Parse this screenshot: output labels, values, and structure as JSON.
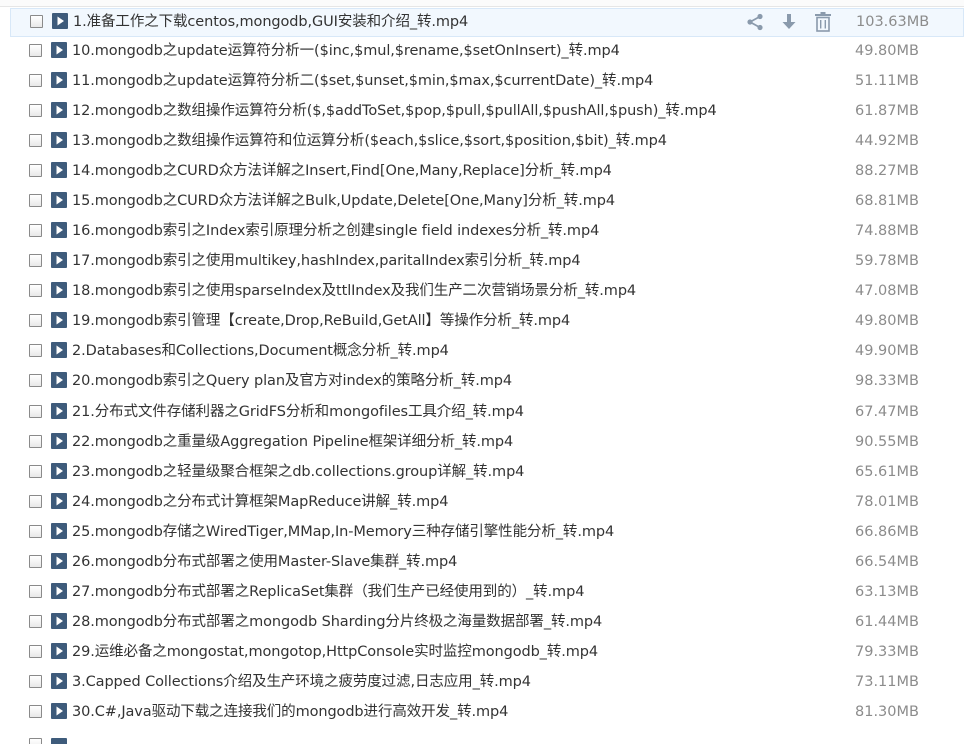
{
  "toolbar_icons": {
    "share": "share-icon",
    "download": "download-icon",
    "delete": "trash-icon",
    "file_type": "video-file-icon",
    "color": "#8a9aac"
  },
  "files": [
    {
      "name": "1.准备工作之下载centos,mongodb,GUI安装和介绍_转.mp4",
      "size": "103.63MB"
    },
    {
      "name": "10.mongodb之update运算符分析一($inc,$mul,$rename,$setOnInsert)_转.mp4",
      "size": "49.80MB"
    },
    {
      "name": "11.mongodb之update运算符分析二($set,$unset,$min,$max,$currentDate)_转.mp4",
      "size": "51.11MB"
    },
    {
      "name": "12.mongodb之数组操作运算符分析($,$addToSet,$pop,$pull,$pullAll,$pushAll,$push)_转.mp4",
      "size": "61.87MB"
    },
    {
      "name": "13.mongodb之数组操作运算符和位运算分析($each,$slice,$sort,$position,$bit)_转.mp4",
      "size": "44.92MB"
    },
    {
      "name": "14.mongodb之CURD众方法详解之Insert,Find[One,Many,Replace]分析_转.mp4",
      "size": "88.27MB"
    },
    {
      "name": "15.mongodb之CURD众方法详解之Bulk,Update,Delete[One,Many]分析_转.mp4",
      "size": "68.81MB"
    },
    {
      "name": "16.mongodb索引之Index索引原理分析之创建single field indexes分析_转.mp4",
      "size": "74.88MB"
    },
    {
      "name": "17.mongodb索引之使用multikey,hashIndex,paritalIndex索引分析_转.mp4",
      "size": "59.78MB"
    },
    {
      "name": "18.mongodb索引之使用sparseIndex及ttlIndex及我们生产二次营销场景分析_转.mp4",
      "size": "47.08MB"
    },
    {
      "name": "19.mongodb索引管理【create,Drop,ReBuild,GetAll】等操作分析_转.mp4",
      "size": "49.80MB"
    },
    {
      "name": "2.Databases和Collections,Document概念分析_转.mp4",
      "size": "49.90MB"
    },
    {
      "name": "20.mongodb索引之Query plan及官方对index的策略分析_转.mp4",
      "size": "98.33MB"
    },
    {
      "name": "21.分布式文件存储利器之GridFS分析和mongofiles工具介绍_转.mp4",
      "size": "67.47MB"
    },
    {
      "name": "22.mongodb之重量级Aggregation Pipeline框架详细分析_转.mp4",
      "size": "90.55MB"
    },
    {
      "name": "23.mongodb之轻量级聚合框架之db.collections.group详解_转.mp4",
      "size": "65.61MB"
    },
    {
      "name": "24.mongodb之分布式计算框架MapReduce讲解_转.mp4",
      "size": "78.01MB"
    },
    {
      "name": "25.mongodb存储之WiredTiger,MMap,In-Memory三种存储引擎性能分析_转.mp4",
      "size": "66.86MB"
    },
    {
      "name": "26.mongodb分布式部署之使用Master-Slave集群_转.mp4",
      "size": "66.54MB"
    },
    {
      "name": "27.mongodb分布式部署之ReplicaSet集群（我们生产已经使用到的）_转.mp4",
      "size": "63.13MB"
    },
    {
      "name": "28.mongodb分布式部署之mongodb Sharding分片终极之海量数据部署_转.mp4",
      "size": "61.44MB"
    },
    {
      "name": "29.运维必备之mongostat,mongotop,HttpConsole实时监控mongodb_转.mp4",
      "size": "79.33MB"
    },
    {
      "name": "3.Capped Collections介绍及生产环境之疲劳度过滤,日志应用_转.mp4",
      "size": "73.11MB"
    },
    {
      "name": "30.C#,Java驱动下载之连接我们的mongodb进行高效开发_转.mp4",
      "size": "81.30MB"
    }
  ]
}
